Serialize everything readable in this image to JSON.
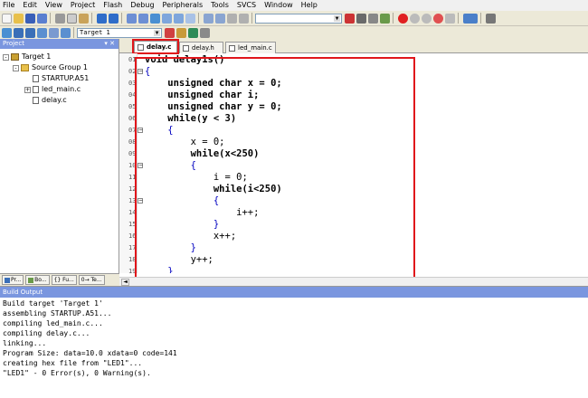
{
  "menu": [
    "File",
    "Edit",
    "View",
    "Project",
    "Flash",
    "Debug",
    "Peripherals",
    "Tools",
    "SVCS",
    "Window",
    "Help"
  ],
  "toolbar": {
    "target_select": "Target 1"
  },
  "project_panel": {
    "title": "Project",
    "tree": [
      {
        "label": "Target 1",
        "level": 0,
        "expander": "-"
      },
      {
        "label": "Source Group 1",
        "level": 1,
        "expander": "-"
      },
      {
        "label": "STARTUP.A51",
        "level": 2,
        "expander": ""
      },
      {
        "label": "led_main.c",
        "level": 2,
        "expander": "+"
      },
      {
        "label": "delay.c",
        "level": 2,
        "expander": ""
      }
    ],
    "tabs": [
      "Pr...",
      "Bo...",
      "{} Fu...",
      "0→ Te..."
    ]
  },
  "editor": {
    "tabs": [
      "delay.c",
      "delay.h",
      "led_main.c"
    ],
    "active_tab": "delay.c",
    "line_numbers": [
      "01",
      "02",
      "03",
      "04",
      "05",
      "06",
      "07",
      "08",
      "09",
      "10",
      "11",
      "12",
      "13",
      "14",
      "15",
      "16",
      "17",
      "18",
      "19"
    ],
    "code_lines": [
      "void delay1s()",
      "{",
      "    unsigned char x = 0;",
      "    unsigned char i;",
      "    unsigned char y = 0;",
      "    while(y < 3)",
      "    {",
      "        x = 0;",
      "        while(x<250)",
      "        {",
      "            i = 0;",
      "            while(i<250)",
      "            {",
      "                i++;",
      "            }",
      "            x++;",
      "        }",
      "        y++;",
      "    }"
    ]
  },
  "build_output": {
    "title": "Build Output",
    "lines": [
      "Build target 'Target 1'",
      "assembling STARTUP.A51...",
      "compiling led_main.c...",
      "compiling delay.c...",
      "linking...",
      "Program Size: data=10.0 xdata=0 code=141",
      "creating hex file from \"LED1\"...",
      "\"LED1\" - 0 Error(s), 0 Warning(s)."
    ]
  },
  "colors": {
    "highlight_border": "#e0161b",
    "panel_header": "#7a96df"
  }
}
